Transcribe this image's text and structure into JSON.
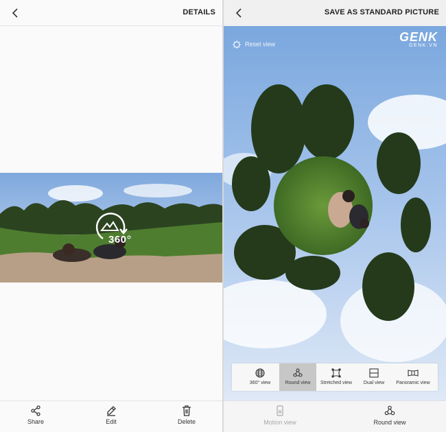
{
  "left": {
    "header": {
      "title": "DETAILS"
    },
    "badge": {
      "text": "360"
    },
    "bottom_bar": {
      "items": [
        {
          "label": "Share",
          "icon": "share-icon"
        },
        {
          "label": "Edit",
          "icon": "pencil-icon"
        },
        {
          "label": "Delete",
          "icon": "trash-icon"
        }
      ]
    }
  },
  "right": {
    "header": {
      "title": "SAVE AS STANDARD PICTURE"
    },
    "reset_label": "Reset view",
    "watermark": {
      "logo": "GENK",
      "sub": "GENK.VN"
    },
    "view_modes": [
      {
        "label": "360° view",
        "icon": "globe-icon",
        "selected": false
      },
      {
        "label": "Round view",
        "icon": "round-view-icon",
        "selected": true
      },
      {
        "label": "Stretched view",
        "icon": "stretched-view-icon",
        "selected": false
      },
      {
        "label": "Dual view",
        "icon": "dual-view-icon",
        "selected": false
      },
      {
        "label": "Panoramic view",
        "icon": "panoramic-view-icon",
        "selected": false
      }
    ],
    "bottom_bar": {
      "items": [
        {
          "label": "Motion view",
          "icon": "motion-view-icon",
          "enabled": false
        },
        {
          "label": "Round view",
          "icon": "round-view-icon",
          "enabled": true
        }
      ]
    }
  },
  "colors": {
    "sky": "#8fb6e4",
    "foliage": "#2f4a22",
    "grass": "#4c7a2c",
    "disabled_text": "#a8a8a8"
  }
}
